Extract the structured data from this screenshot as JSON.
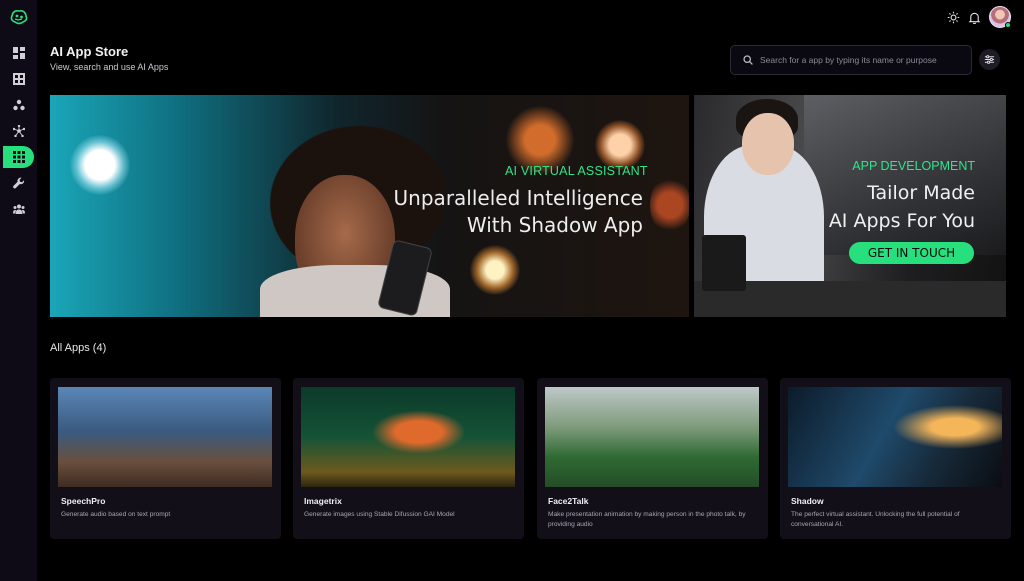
{
  "header": {
    "title": "AI App Store",
    "subtitle": "View, search and use AI Apps",
    "search_placeholder": "Search for a app by typing its name or purpose"
  },
  "sidebar": {
    "items": [
      {
        "icon": "dashboard-icon"
      },
      {
        "icon": "grid-icon"
      },
      {
        "icon": "nodes-icon"
      },
      {
        "icon": "network-icon"
      },
      {
        "icon": "apps-icon",
        "active": true
      },
      {
        "icon": "wrench-icon"
      },
      {
        "icon": "team-icon"
      }
    ]
  },
  "banners": {
    "main": {
      "eyebrow": "AI VIRTUAL ASSISTANT",
      "headline_line1": "Unparalleled Intelligence",
      "headline_line2": "With Shadow App"
    },
    "side": {
      "eyebrow": "APP DEVELOPMENT",
      "headline_line1": "Tailor Made",
      "headline_line2": "AI Apps For You",
      "cta": "GET IN TOUCH"
    }
  },
  "apps": {
    "section_title": "All Apps (4)",
    "items": [
      {
        "name": "SpeechPro",
        "description": "Generate audio based on text prompt"
      },
      {
        "name": "Imagetrix",
        "description": "Generate images using Stable Difussion GAI Model"
      },
      {
        "name": "Face2Talk",
        "description": "Make presentation animation by making person in the photo talk, by providing audio"
      },
      {
        "name": "Shadow",
        "description": "The perfect virtual assistant. Unlocking the full potential of conversational AI."
      }
    ]
  },
  "colors": {
    "accent": "#27e07d",
    "background": "#000000",
    "card": "#120f19"
  }
}
